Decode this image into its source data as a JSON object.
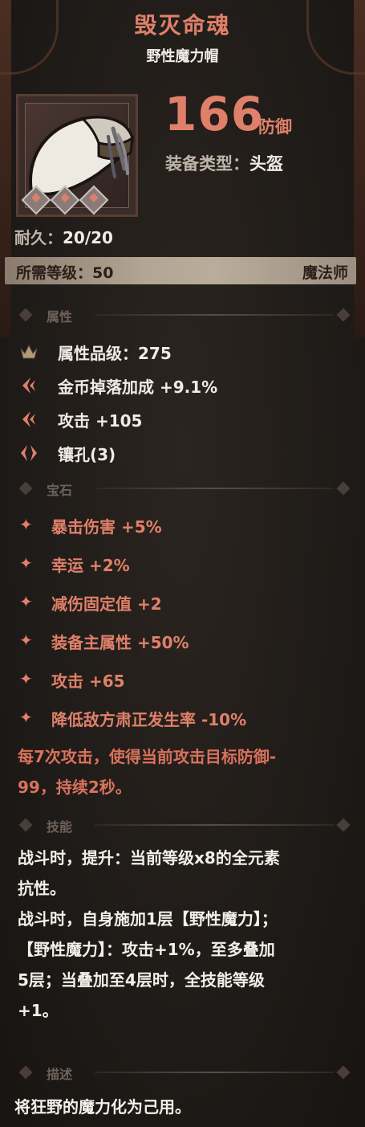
{
  "item": {
    "name": "毁灭命魂",
    "base_name": "野性魔力帽",
    "defense_value": "166",
    "defense_unit": "防御",
    "equip_type_label": "装备类型：",
    "equip_type_value": "头盔",
    "durability_label": "耐久：",
    "durability_value": "20/20",
    "socket_count": 3
  },
  "requirement": {
    "level_text": "所需等级：50",
    "class_text": "魔法师"
  },
  "sections": {
    "attributes": "属性",
    "gems": "宝石",
    "skills": "技能",
    "description": "描述"
  },
  "attributes": [
    {
      "icon": "quality-crown-icon",
      "text": "属性品级：275"
    },
    {
      "icon": "gold-drop-icon",
      "text": "金币掉落加成 +9.1%"
    },
    {
      "icon": "attack-icon",
      "text": "攻击 +105"
    },
    {
      "icon": "socket-icon",
      "text": "镶孔(3)"
    }
  ],
  "gems": [
    "暴击伤害 +5%",
    "幸运 +2%",
    "减伤固定值 +2",
    "装备主属性 +50%",
    "攻击 +65",
    "降低敌方肃正发生率 -10%"
  ],
  "special_effect": [
    "每7次攻击，使得当前攻击目标防御-",
    "99，持续2秒。"
  ],
  "skills": [
    "战斗时，提升：当前等级x8的全元素",
    "抗性。",
    "战斗时，自身施加1层【野性魔力】；",
    "【野性魔力】：攻击+1%，至多叠加",
    "5层；当叠加至4层时，全技能等级",
    "+1。"
  ],
  "description": "将狂野的魔力化为己用。",
  "colors": {
    "accent": "#e0806a",
    "text": "#f0ebe4",
    "muted": "#6d625a"
  }
}
